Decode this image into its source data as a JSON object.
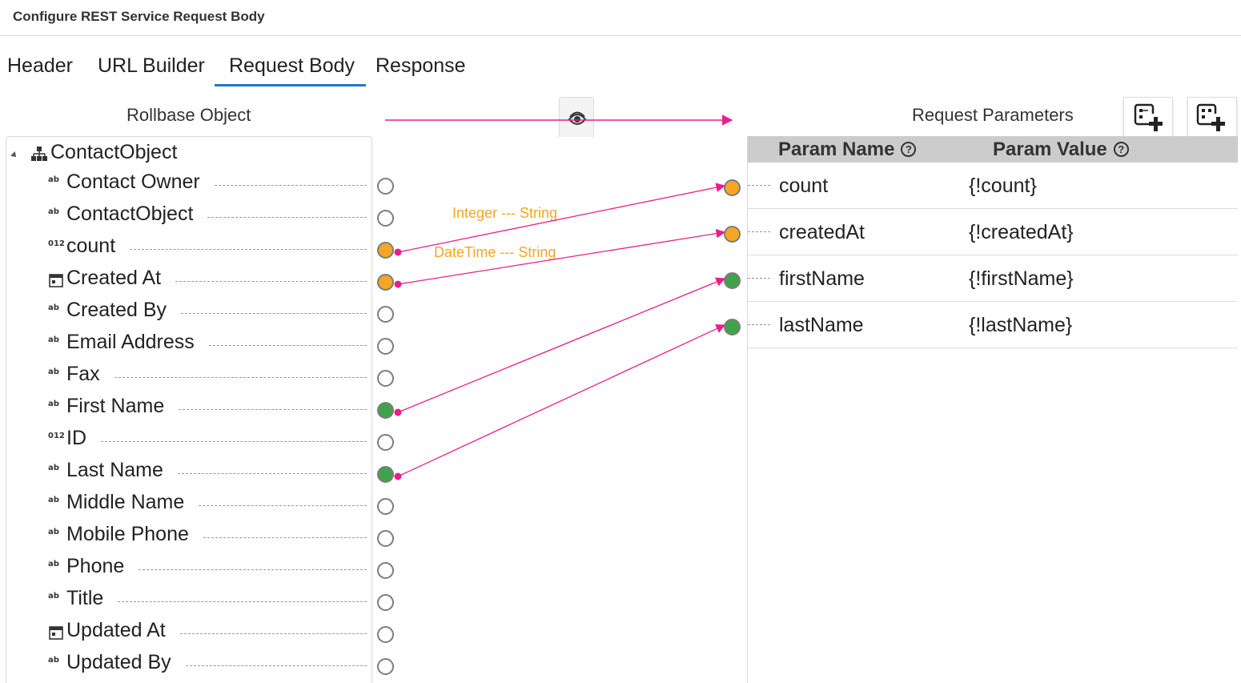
{
  "window": {
    "title": "Configure REST Service Request Body"
  },
  "tabs": [
    {
      "label": "Header",
      "active": false
    },
    {
      "label": "URL Builder",
      "active": false
    },
    {
      "label": "Request Body",
      "active": true
    },
    {
      "label": "Response",
      "active": false
    }
  ],
  "left_panel": {
    "title": "Rollbase Object",
    "root": {
      "label": "ContactObject",
      "icon": "hierarchy-icon",
      "expanded": true
    },
    "fields": [
      {
        "label": "Contact Owner",
        "type_icon": "text-type-icon",
        "status": "unmapped"
      },
      {
        "label": "ContactObject",
        "type_icon": "text-type-icon",
        "status": "unmapped"
      },
      {
        "label": "count",
        "type_icon": "number-type-icon",
        "status": "converted"
      },
      {
        "label": "Created At",
        "type_icon": "calendar-type-icon",
        "status": "converted"
      },
      {
        "label": "Created By",
        "type_icon": "text-type-icon",
        "status": "unmapped"
      },
      {
        "label": "Email Address",
        "type_icon": "text-type-icon",
        "status": "unmapped"
      },
      {
        "label": "Fax",
        "type_icon": "text-type-icon",
        "status": "unmapped"
      },
      {
        "label": "First Name",
        "type_icon": "text-type-icon",
        "status": "mapped"
      },
      {
        "label": "ID",
        "type_icon": "number-type-icon",
        "status": "unmapped"
      },
      {
        "label": "Last Name",
        "type_icon": "text-type-icon",
        "status": "mapped"
      },
      {
        "label": "Middle Name",
        "type_icon": "text-type-icon",
        "status": "unmapped"
      },
      {
        "label": "Mobile Phone",
        "type_icon": "text-type-icon",
        "status": "unmapped"
      },
      {
        "label": "Phone",
        "type_icon": "text-type-icon",
        "status": "unmapped"
      },
      {
        "label": "Title",
        "type_icon": "text-type-icon",
        "status": "unmapped"
      },
      {
        "label": "Updated At",
        "type_icon": "calendar-type-icon",
        "status": "unmapped"
      },
      {
        "label": "Updated By",
        "type_icon": "text-type-icon",
        "status": "unmapped"
      }
    ],
    "type_glyphs": {
      "text": "ab",
      "number": "012"
    }
  },
  "toggle": {
    "icon": "eye-icon"
  },
  "right_panel": {
    "title": "Request Parameters",
    "add_buttons": [
      {
        "icon": "add-param-icon"
      },
      {
        "icon": "add-param-group-icon"
      }
    ],
    "columns": {
      "name": "Param Name",
      "value": "Param Value",
      "help_glyph": "?"
    },
    "rows": [
      {
        "name": "count",
        "value": "{!count}",
        "status": "converted"
      },
      {
        "name": "createdAt",
        "value": "{!createdAt}",
        "status": "converted"
      },
      {
        "name": "firstName",
        "value": "{!firstName}",
        "status": "mapped"
      },
      {
        "name": "lastName",
        "value": "{!lastName}",
        "status": "mapped"
      }
    ]
  },
  "mappings": [
    {
      "from": "count",
      "to": "count",
      "conversion": "Integer --- String"
    },
    {
      "from": "Created At",
      "to": "createdAt",
      "conversion": "DateTime --- String"
    },
    {
      "from": "First Name",
      "to": "firstName",
      "conversion": ""
    },
    {
      "from": "Last Name",
      "to": "lastName",
      "conversion": ""
    }
  ],
  "colors": {
    "link_line": "#e91e8c",
    "converted": "#f5a623",
    "mapped": "#3fa34a",
    "active_tab": "#2a7ab8",
    "grid_header": "#cccccc"
  }
}
